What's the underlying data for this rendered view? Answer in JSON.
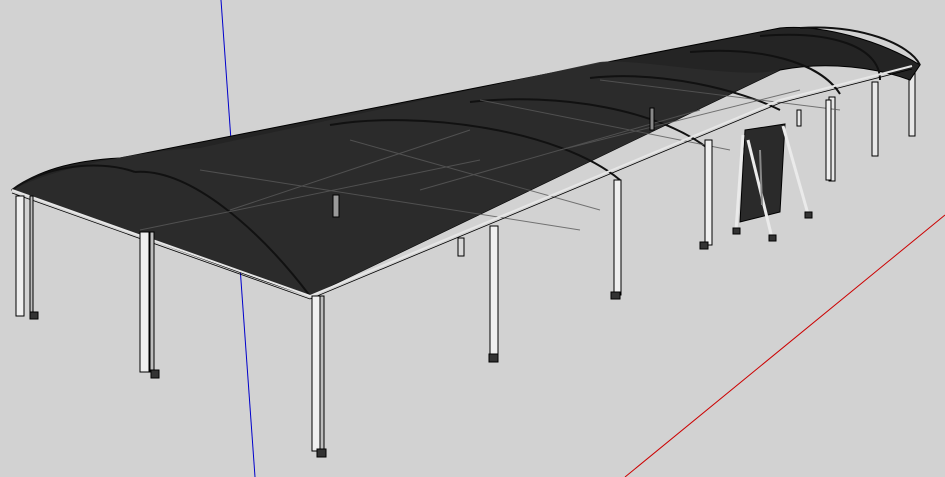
{
  "scene": {
    "description_label": "",
    "background_color": "#d2d2d2",
    "roof_color": "#262626",
    "frame_color": "#f0f0f0",
    "outline_color": "#000000",
    "axis_blue": "#0000cc",
    "axis_red": "#cc0000"
  }
}
